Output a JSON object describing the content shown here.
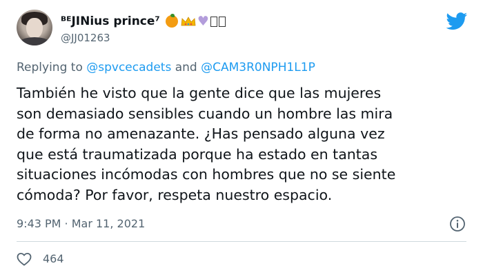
{
  "user": {
    "display_name": "ᴮᴱJINius prince⁷",
    "handle": "@JJ01263",
    "emoji_names": [
      "orange-emoji",
      "crown-emoji",
      "purple-heart-emoji",
      "unsupported-glyph",
      "unsupported-glyph"
    ]
  },
  "reply": {
    "prefix": "Replying to",
    "mention_1": "@spvcecadets",
    "conjunction": "and",
    "mention_2": "@CAM3R0NPH1L1P"
  },
  "tweet": {
    "lines": [
      "También he visto que la gente dice que las mujeres",
      "son demasiado sensibles cuando un hombre las mira",
      "de forma no amenazante. ¿Has pensado alguna vez",
      "que está traumatizada porque ha estado en tantas",
      "situaciones incómodas con hombres que no se siente",
      "cómoda? Por favor, respeta nuestro espacio."
    ],
    "timestamp": "9:43 PM · Mar 11, 2021"
  },
  "engagement": {
    "likes": "464"
  },
  "colors": {
    "text": "#0f1419",
    "secondary": "#536471",
    "link": "#1d9bf0",
    "divider": "#cfd9de",
    "twitter_blue": "#1d9bf0"
  },
  "icons": [
    "twitter-bird-icon",
    "info-icon",
    "heart-icon"
  ]
}
